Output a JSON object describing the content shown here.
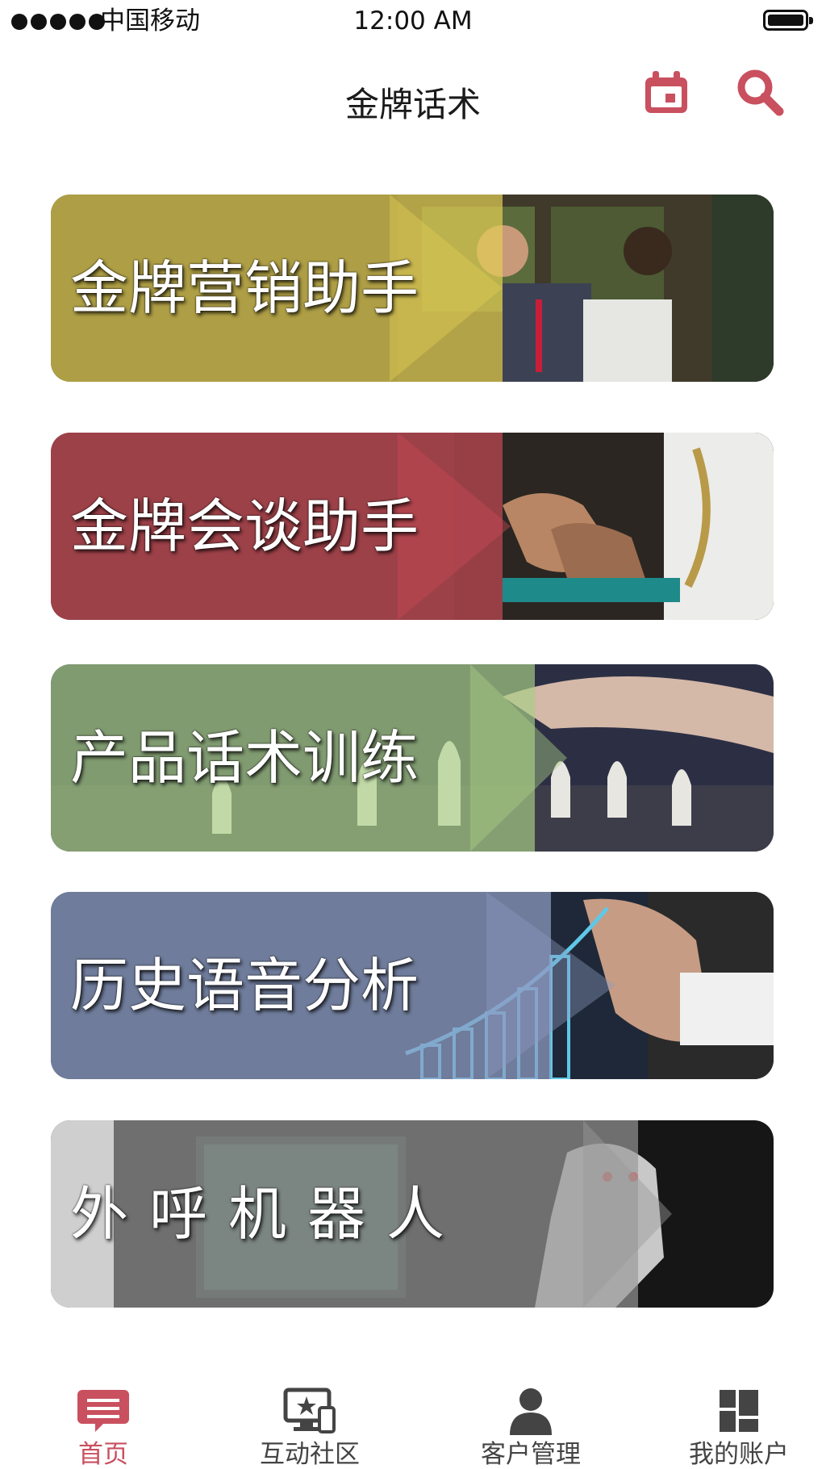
{
  "status_bar": {
    "carrier": "中国移动",
    "time": "12:00 AM",
    "signal_icon": "signal-dots-icon",
    "battery_icon": "battery-icon"
  },
  "header": {
    "title": "金牌话术",
    "calendar_icon": "calendar-icon",
    "search_icon": "search-icon",
    "accent_color": "#c9505f"
  },
  "cards": [
    {
      "label": "金牌营销助手",
      "tint": "#e1cc55"
    },
    {
      "label": "金牌会谈助手",
      "tint": "#c84a55"
    },
    {
      "label": "产品话术训练",
      "tint": "#a9cf86"
    },
    {
      "label": "历史语音分析",
      "tint": "#8f9cc2"
    },
    {
      "label": "外呼机器人",
      "tint": "#9a9a9a"
    }
  ],
  "tabbar": {
    "items": [
      {
        "label": "首页",
        "icon": "chat-bubble-icon",
        "active": true
      },
      {
        "label": "互动社区",
        "icon": "monitor-star-icon",
        "active": false
      },
      {
        "label": "客户管理",
        "icon": "person-icon",
        "active": false
      },
      {
        "label": "我的账户",
        "icon": "dashboard-grid-icon",
        "active": false
      }
    ],
    "active_color": "#c9505f",
    "inactive_color": "#444444"
  }
}
